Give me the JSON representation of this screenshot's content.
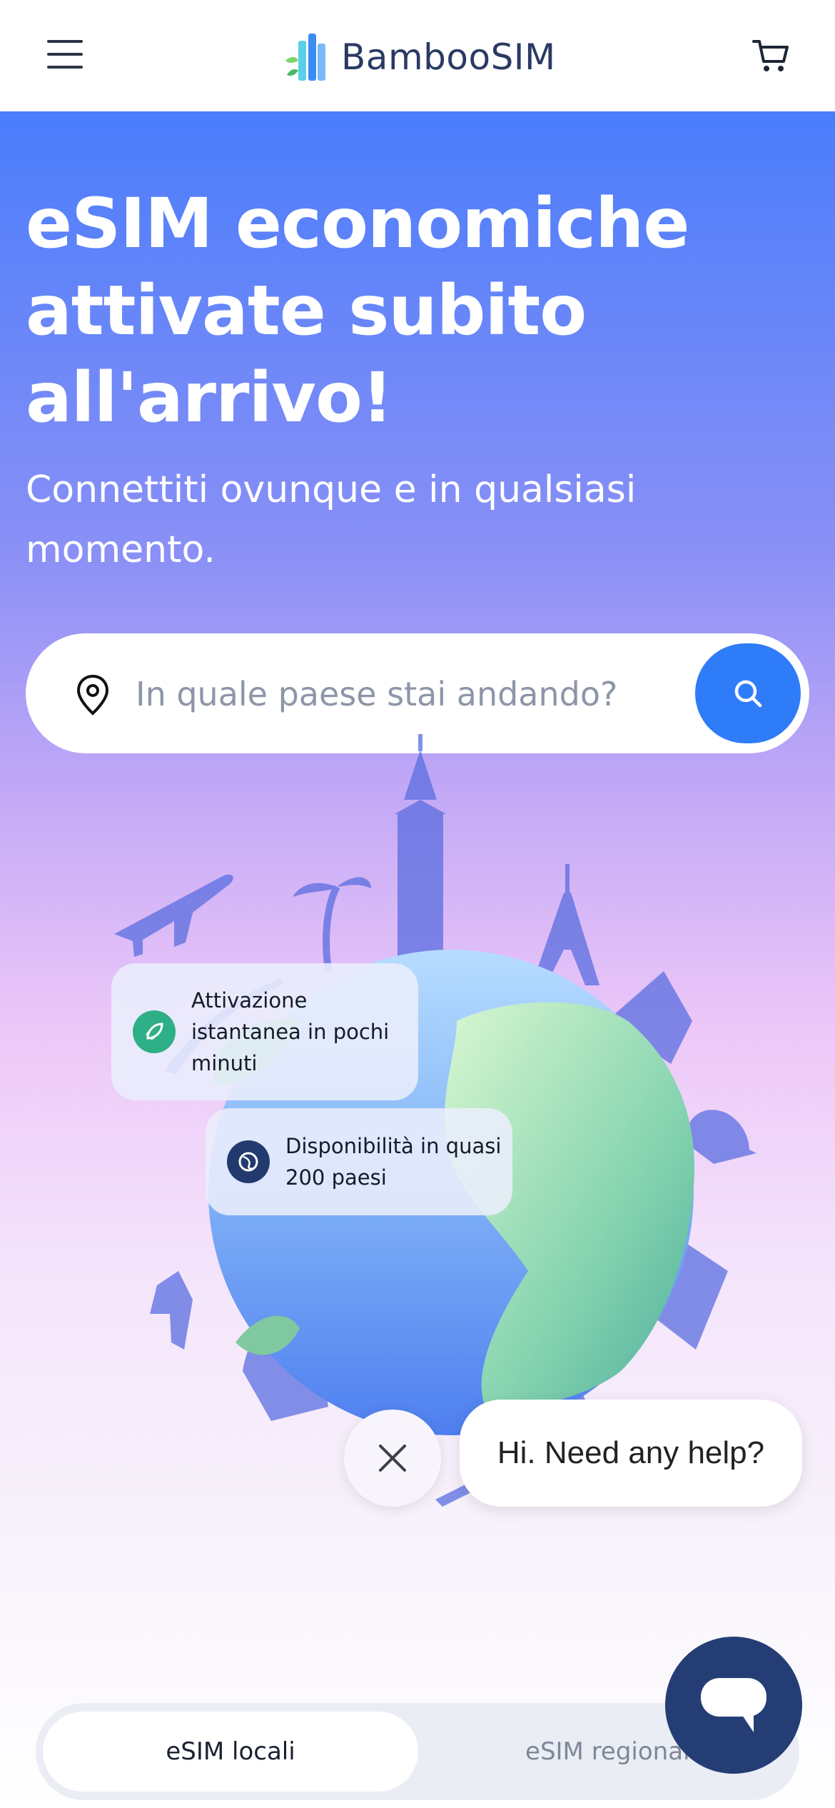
{
  "header": {
    "logo_text": "BambooSIM",
    "menu_icon": "hamburger-menu-icon",
    "cart_icon": "cart-icon"
  },
  "hero": {
    "headline": "eSIM economiche attivate subito all'arrivo!",
    "subheadline": "Connettiti ovunque e in qualsiasi momento."
  },
  "search": {
    "placeholder": "In quale paese stai andando?",
    "location_icon": "map-pin-icon",
    "button_icon": "search-icon"
  },
  "features": [
    {
      "text": "Attivazione istantanea in pochi minuti",
      "icon": "rocket-icon",
      "color": "#2eaf86"
    },
    {
      "text": "Disponibilità in quasi 200 paesi",
      "icon": "globe-icon",
      "color": "#233a6e"
    }
  ],
  "chat": {
    "bubble_text": "Hi. Need any help?",
    "close_icon": "close-icon",
    "launcher_icon": "chat-icon"
  },
  "tabs": [
    {
      "label": "eSIM locali",
      "active": true
    },
    {
      "label": "eSIM regionali",
      "active": false
    }
  ],
  "colors": {
    "brand_blue": "#2f7cf8",
    "hero_top": "#4a7dfb",
    "chat_navy": "#243e75",
    "text_dark": "#2a3a64"
  }
}
